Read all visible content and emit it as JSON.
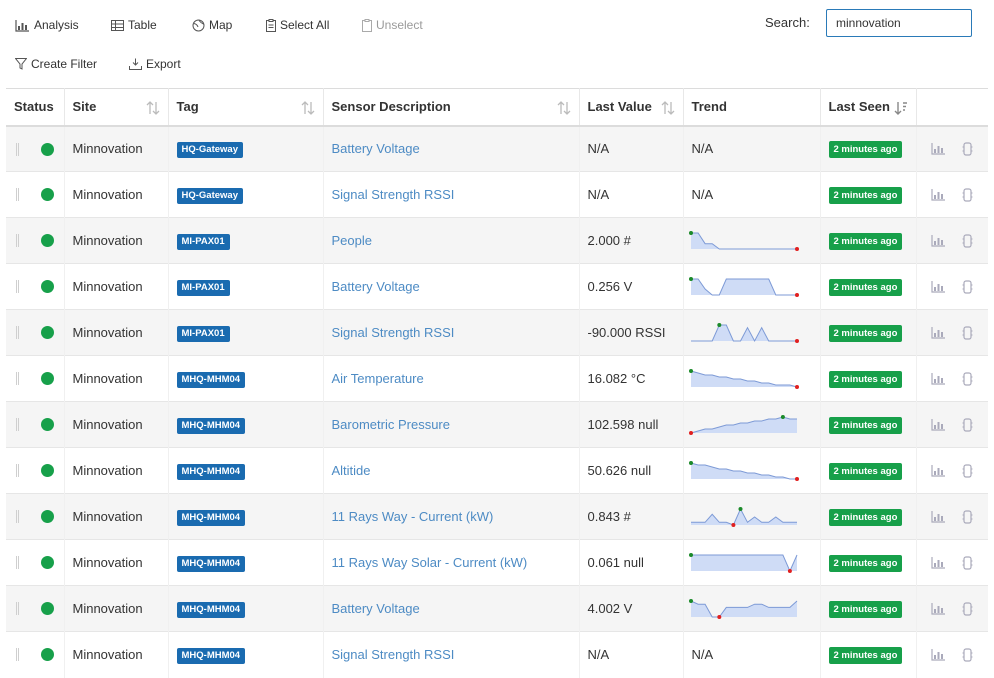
{
  "toolbar": {
    "analysis_label": "Analysis",
    "table_label": "Table",
    "map_label": "Map",
    "select_all_label": "Select All",
    "unselect_label": "Unselect",
    "create_filter_label": "Create Filter",
    "export_label": "Export",
    "search_label": "Search:",
    "search_value": "minnovation"
  },
  "columns": {
    "status": "Status",
    "site": "Site",
    "tag": "Tag",
    "description": "Sensor Description",
    "last_value": "Last Value",
    "trend": "Trend",
    "last_seen": "Last Seen"
  },
  "colors": {
    "status_ok": "#17a04a",
    "tag_bg": "#1a6bb0",
    "link": "#4d8bc4",
    "badge_green": "#17a04a"
  },
  "rows": [
    {
      "site": "Minnovation",
      "tag": "HQ-Gateway",
      "description": "Battery Voltage",
      "last_value": "N/A",
      "trend_text": "N/A",
      "trend": null,
      "last_seen": "2 minutes ago"
    },
    {
      "site": "Minnovation",
      "tag": "HQ-Gateway",
      "description": "Signal Strength RSSI",
      "last_value": "N/A",
      "trend_text": "N/A",
      "trend": null,
      "last_seen": "2 minutes ago"
    },
    {
      "site": "Minnovation",
      "tag": "MI-PAX01",
      "description": "People",
      "last_value": "2.000 #",
      "trend_text": "",
      "trend": [
        6,
        6,
        4,
        4,
        3,
        3,
        3,
        3,
        3,
        3,
        3,
        3,
        3,
        3,
        3,
        3
      ],
      "last_seen": "2 minutes ago"
    },
    {
      "site": "Minnovation",
      "tag": "MI-PAX01",
      "description": "Battery Voltage",
      "last_value": "0.256 V",
      "trend_text": "",
      "trend": [
        9,
        9,
        4,
        1,
        1,
        9,
        9,
        9,
        9,
        9,
        9,
        9,
        1,
        1,
        1,
        1
      ],
      "last_seen": "2 minutes ago"
    },
    {
      "site": "Minnovation",
      "tag": "MI-PAX01",
      "description": "Signal Strength RSSI",
      "last_value": "-90.000 RSSI",
      "trend_text": "",
      "trend": [
        2,
        2,
        2,
        2,
        8,
        8,
        2,
        2,
        7,
        2,
        7,
        2,
        2,
        2,
        2,
        2
      ],
      "last_seen": "2 minutes ago"
    },
    {
      "site": "Minnovation",
      "tag": "MHQ-MHM04",
      "description": "Air Temperature",
      "last_value": "16.082 °C",
      "trend_text": "",
      "trend": [
        9,
        8,
        7,
        7,
        6,
        6,
        5,
        5,
        4,
        4,
        3,
        3,
        2,
        2,
        2,
        1
      ],
      "last_seen": "2 minutes ago"
    },
    {
      "site": "Minnovation",
      "tag": "MHQ-MHM04",
      "description": "Barometric Pressure",
      "last_value": "102.598 null",
      "trend_text": "",
      "trend": [
        1,
        2,
        3,
        3,
        4,
        5,
        5,
        6,
        6,
        7,
        7,
        8,
        8,
        9,
        8,
        8
      ],
      "last_seen": "2 minutes ago"
    },
    {
      "site": "Minnovation",
      "tag": "MHQ-MHM04",
      "description": "Altitide",
      "last_value": "50.626 null",
      "trend_text": "",
      "trend": [
        9,
        8,
        8,
        7,
        6,
        6,
        5,
        5,
        4,
        4,
        3,
        3,
        2,
        2,
        1,
        1
      ],
      "last_seen": "2 minutes ago"
    },
    {
      "site": "Minnovation",
      "tag": "MHQ-MHM04",
      "description": "11 Rays Way - Current (kW)",
      "last_value": "0.843 #",
      "trend_text": "",
      "trend": [
        3,
        3,
        3,
        6,
        3,
        3,
        2,
        8,
        3,
        5,
        3,
        3,
        5,
        3,
        3,
        3
      ],
      "last_seen": "2 minutes ago"
    },
    {
      "site": "Minnovation",
      "tag": "MHQ-MHM04",
      "description": "11 Rays Way Solar - Current (kW)",
      "last_value": "0.061 null",
      "trend_text": "",
      "trend": [
        9,
        9,
        9,
        9,
        9,
        9,
        9,
        9,
        9,
        9,
        9,
        9,
        9,
        9,
        1,
        9
      ],
      "last_seen": "2 minutes ago"
    },
    {
      "site": "Minnovation",
      "tag": "MHQ-MHM04",
      "description": "Battery Voltage",
      "last_value": "4.002 V",
      "trend_text": "",
      "trend": [
        7,
        6,
        6,
        2,
        2,
        5,
        5,
        5,
        5,
        6,
        6,
        5,
        5,
        5,
        5,
        7
      ],
      "last_seen": "2 minutes ago"
    },
    {
      "site": "Minnovation",
      "tag": "MHQ-MHM04",
      "description": "Signal Strength RSSI",
      "last_value": "N/A",
      "trend_text": "N/A",
      "trend": null,
      "last_seen": "2 minutes ago"
    }
  ]
}
